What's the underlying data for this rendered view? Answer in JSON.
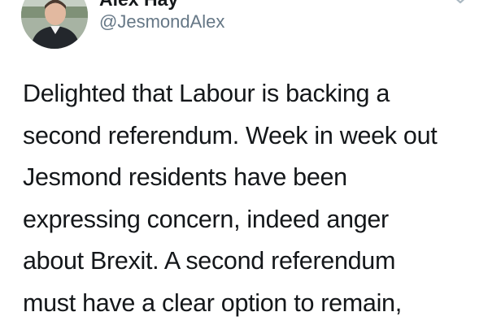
{
  "author": {
    "display_name": "Alex Hay",
    "handle": "@JesmondAlex",
    "avatar_icon": "profile-photo",
    "menu_icon": "chevron-down-icon"
  },
  "tweet": {
    "lines": [
      "Delighted that Labour is backing a",
      "second referendum. Week in week out",
      "Jesmond residents have been",
      "expressing concern, indeed anger",
      "about Brexit. A second referendum",
      "must have a clear option to remain,"
    ]
  },
  "colors": {
    "text": "#14171a",
    "secondary_text": "#657786",
    "background": "#ffffff"
  }
}
